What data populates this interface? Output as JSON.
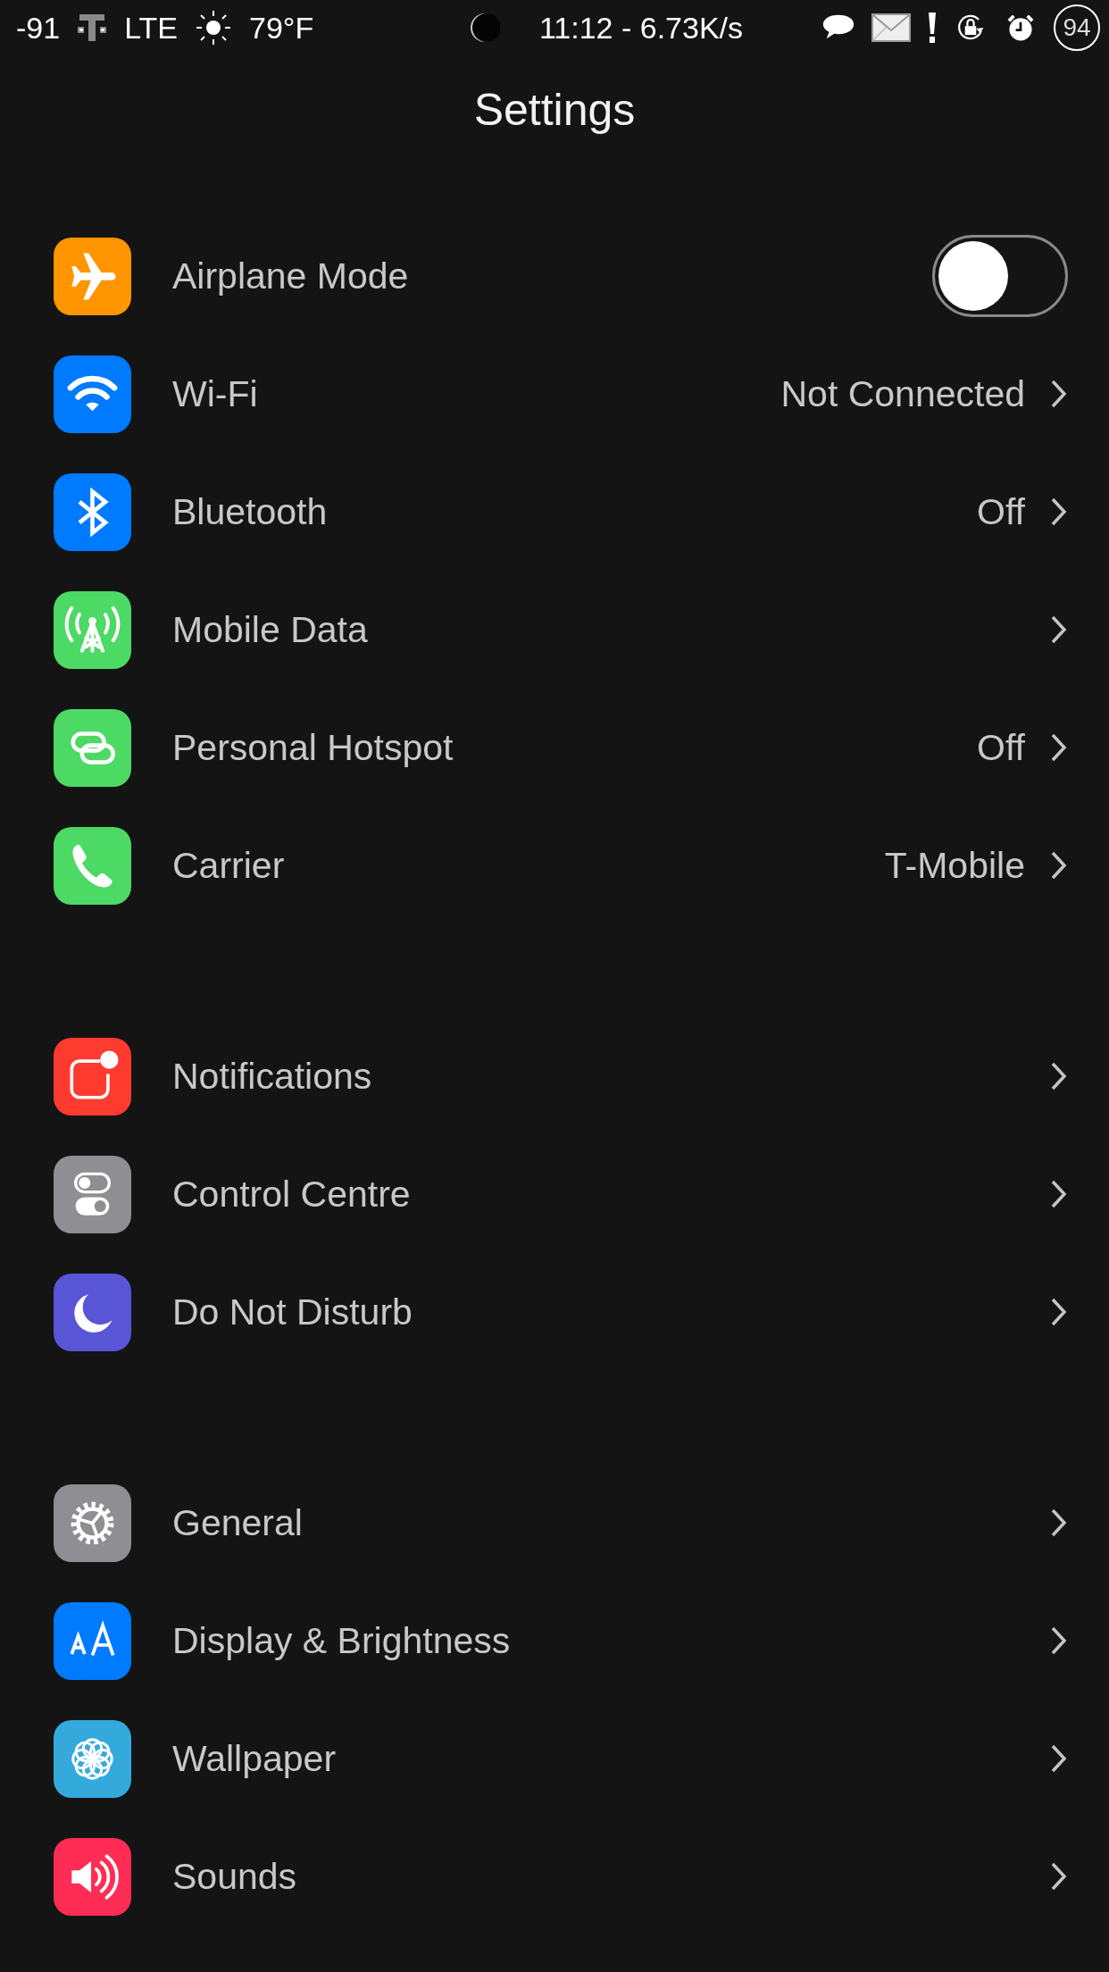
{
  "status_bar": {
    "signal": "-91",
    "network": "LTE",
    "temperature": "79°F",
    "time_speed": "11:12 - 6.73K/s",
    "battery": "94"
  },
  "title": "Settings",
  "groups": [
    {
      "rows": [
        {
          "kind": "toggle",
          "label": "Airplane Mode",
          "color": "#ff9500",
          "on": false
        },
        {
          "kind": "link",
          "label": "Wi-Fi",
          "value": "Not Connected",
          "color": "#007aff"
        },
        {
          "kind": "link",
          "label": "Bluetooth",
          "value": "Off",
          "color": "#007aff"
        },
        {
          "kind": "link",
          "label": "Mobile Data",
          "color": "#4cd964"
        },
        {
          "kind": "link",
          "label": "Personal Hotspot",
          "value": "Off",
          "color": "#4cd964"
        },
        {
          "kind": "link",
          "label": "Carrier",
          "value": "T-Mobile",
          "color": "#4cd964"
        }
      ]
    },
    {
      "rows": [
        {
          "kind": "link",
          "label": "Notifications",
          "color": "#ff3b30"
        },
        {
          "kind": "link",
          "label": "Control Centre",
          "color": "#8e8e93"
        },
        {
          "kind": "link",
          "label": "Do Not Disturb",
          "color": "#5856d6"
        }
      ]
    },
    {
      "rows": [
        {
          "kind": "link",
          "label": "General",
          "color": "#8e8e93"
        },
        {
          "kind": "link",
          "label": "Display & Brightness",
          "color": "#007aff"
        },
        {
          "kind": "link",
          "label": "Wallpaper",
          "color": "#34aadc"
        },
        {
          "kind": "link",
          "label": "Sounds",
          "color": "#ff2d55"
        }
      ]
    }
  ]
}
